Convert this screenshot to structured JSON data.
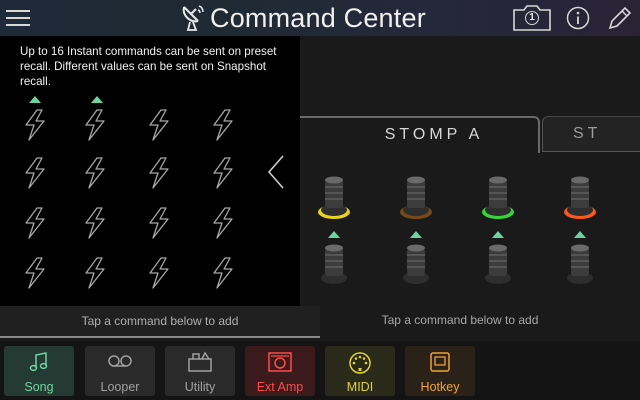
{
  "header": {
    "title": "Command Center",
    "menu_icon": "hamburger-menu-icon",
    "logo_icon": "command-center-satellite-icon",
    "snapshot_icon": "camera-snapshot-icon",
    "snapshot_badge": "1",
    "info_icon": "info-icon",
    "edit_icon": "pencil-icon"
  },
  "panel": {
    "description": "Up to 16 Instant commands can be sent on preset recall. Different values can be sent on Snapshot recall.",
    "footer_hint": "Tap a command below to add",
    "collapse_icon": "chevron-left-icon",
    "command_icon": "lightning-bolt-icon"
  },
  "stomp": {
    "tabs": [
      "STOMP A",
      "ST"
    ],
    "hint": "Tap a command below to add",
    "led_colors": [
      "#e8d21c",
      "#7a4a18",
      "#35d63a",
      "#ff5a1e"
    ]
  },
  "bottom_tabs": [
    {
      "label": "Song",
      "icon": "music-note-icon",
      "color": "#6fd3a0",
      "bg": "#263a34"
    },
    {
      "label": "Looper",
      "icon": "looper-tape-icon",
      "color": "#a0a0a0",
      "bg": "#2a2a2a"
    },
    {
      "label": "Utility",
      "icon": "utility-icon",
      "color": "#a0a0a0",
      "bg": "#2a2a2a"
    },
    {
      "label": "Ext Amp",
      "icon": "amp-icon",
      "color": "#ff4a4a",
      "bg": "#3a1a1a"
    },
    {
      "label": "MIDI",
      "icon": "midi-din-icon",
      "color": "#e0d23a",
      "bg": "#2a2a1a"
    },
    {
      "label": "Hotkey",
      "icon": "hotkey-icon",
      "color": "#f0a23a",
      "bg": "#2a2218"
    }
  ],
  "colors": {
    "accent": "#6fd3a0"
  }
}
